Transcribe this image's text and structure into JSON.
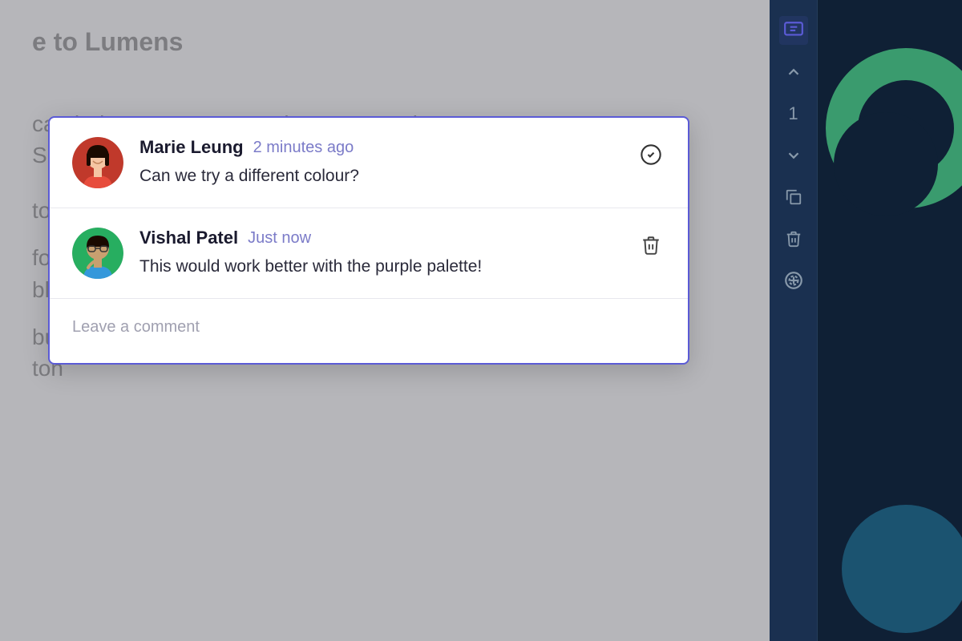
{
  "background": {
    "lines": [
      "e to Lumens",
      "can help you turn your written content into",
      "Simply copy + paste your text here or copy",
      "to th",
      "for ",
      "bloc",
      "bui",
      "ton"
    ]
  },
  "comments": [
    {
      "id": "comment-1",
      "author": "Marie Leung",
      "time": "2 minutes ago",
      "text": "Can we try a different colour?",
      "action_icon": "check-circle-icon",
      "avatar_label": "marie-avatar"
    },
    {
      "id": "comment-2",
      "author": "Vishal Patel",
      "time": "Just now",
      "text": "This would work better with the purple palette!",
      "action_icon": "delete-icon",
      "avatar_label": "vishal-avatar"
    }
  ],
  "input": {
    "placeholder": "Leave a comment"
  },
  "sidebar": {
    "tools": [
      {
        "name": "comment-tool",
        "label": "💬"
      },
      {
        "name": "chevron-up-tool",
        "label": "∧"
      },
      {
        "name": "number-tool",
        "label": "1"
      },
      {
        "name": "chevron-down-tool",
        "label": "∨"
      },
      {
        "name": "copy-tool",
        "label": "⧉"
      },
      {
        "name": "delete-tool",
        "label": "🗑"
      },
      {
        "name": "add-circle-tool",
        "label": "⊕"
      }
    ]
  },
  "colors": {
    "accent_blue": "#5b5bd6",
    "time_color": "#7b7bc8",
    "sidebar_bg": "#0f2035",
    "green_ring": "#3a9b6e"
  }
}
